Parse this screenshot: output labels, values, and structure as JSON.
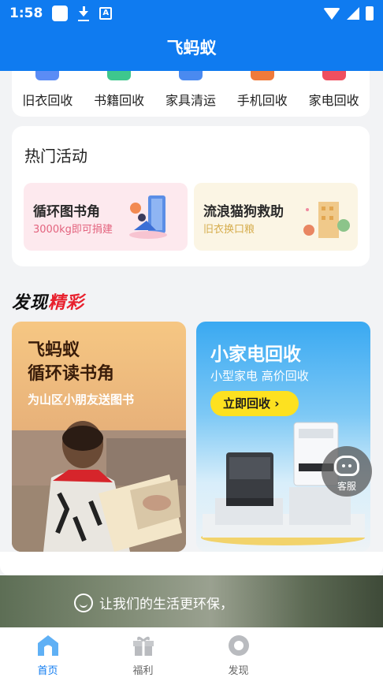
{
  "status_bar": {
    "time": "1:58"
  },
  "app_title": "飞蚂蚁",
  "categories": [
    {
      "label": "旧衣回收",
      "color": "#5b8cf5"
    },
    {
      "label": "书籍回收",
      "color": "#3ec78d"
    },
    {
      "label": "家具清运",
      "color": "#4a8af0"
    },
    {
      "label": "手机回收",
      "color": "#f07a3a"
    },
    {
      "label": "家电回收",
      "color": "#ef4f5f"
    }
  ],
  "hot_events": {
    "title": "热门活动",
    "items": [
      {
        "title": "循环图书角",
        "subtitle": "3000kg即可捐建"
      },
      {
        "title": "流浪猫狗救助",
        "subtitle": "旧衣换口粮"
      }
    ]
  },
  "discover": {
    "heading_black": "发现",
    "heading_red": "精彩",
    "left": {
      "title_line1": "飞蚂蚁",
      "title_line2": "循环读书角",
      "subtitle": "为山区小朋友送图书"
    },
    "right": {
      "title": "小家电回收",
      "subtitle": "小型家电 高价回收",
      "button": "立即回收 ›"
    }
  },
  "service": {
    "label": "客服"
  },
  "slogan": "让我们的生活更环保，",
  "tabs": [
    {
      "label": "首页",
      "icon": "home-icon",
      "active": true
    },
    {
      "label": "福利",
      "icon": "gift-icon",
      "active": false
    },
    {
      "label": "发现",
      "icon": "discover-icon",
      "active": false
    },
    {
      "label": "",
      "icon": "",
      "active": false
    }
  ],
  "colors": {
    "primary": "#0f7bf0",
    "accent_red": "#e8202d",
    "button_yellow": "#fde120"
  }
}
